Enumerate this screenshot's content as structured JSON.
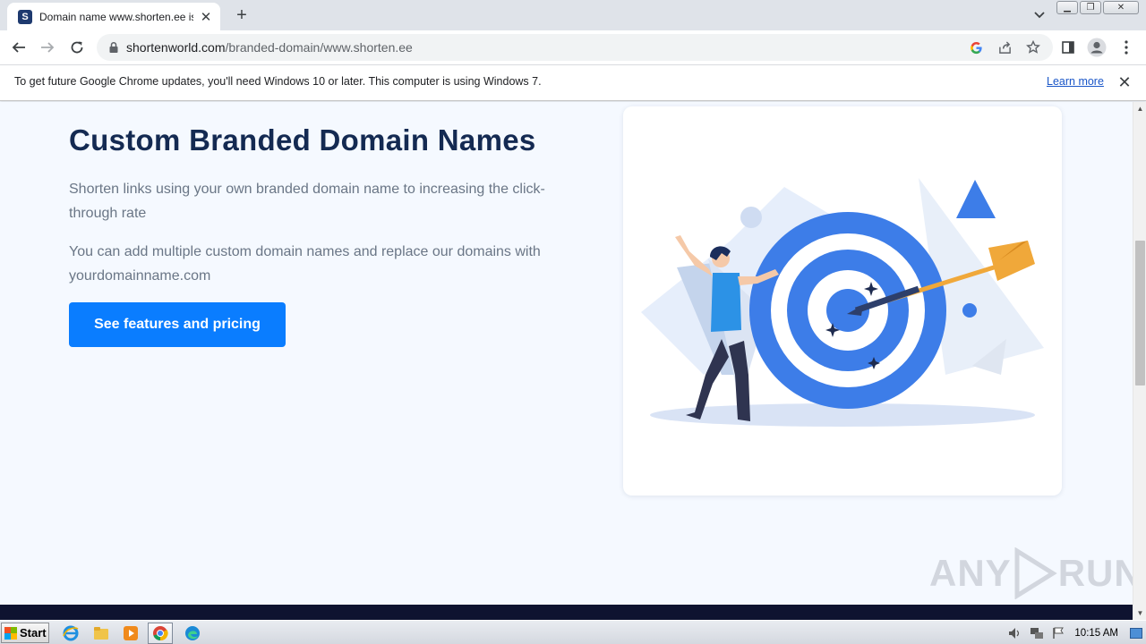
{
  "browser": {
    "tab": {
      "favicon_letter": "S",
      "title": "Domain name www.shorten.ee is being"
    },
    "url": {
      "domain": "shortenworld.com",
      "path": "/branded-domain/www.shorten.ee"
    },
    "icons": {
      "back": "back-arrow-icon",
      "forward": "forward-arrow-icon",
      "reload": "reload-icon",
      "google": "google-icon",
      "share": "share-icon",
      "bookmark": "star-icon",
      "sidepanel": "side-panel-icon",
      "profile": "profile-icon",
      "menu": "kebab-menu-icon"
    }
  },
  "infobar": {
    "message": "To get future Google Chrome updates, you'll need Windows 10 or later. This computer is using Windows 7.",
    "link": "Learn more"
  },
  "page": {
    "heading": "Custom Branded Domain Names",
    "paragraph1": "Shorten links using your own branded domain name to increasing the click-through rate",
    "paragraph2": "You can add multiple custom domain names and replace our domains with yourdomainname.com",
    "cta": "See features and pricing",
    "colors": {
      "heading": "#142a52",
      "cta": "#0a7dff",
      "target_blue": "#3d7de8",
      "arrow_gold": "#f0a83a",
      "footer": "#0e1330"
    }
  },
  "watermark": {
    "left": "ANY",
    "right": "RUN"
  },
  "taskbar": {
    "start": "Start",
    "clock": "10:15 AM",
    "apps": [
      "ie-icon",
      "explorer-icon",
      "media-player-icon",
      "chrome-icon",
      "edge-icon"
    ]
  }
}
